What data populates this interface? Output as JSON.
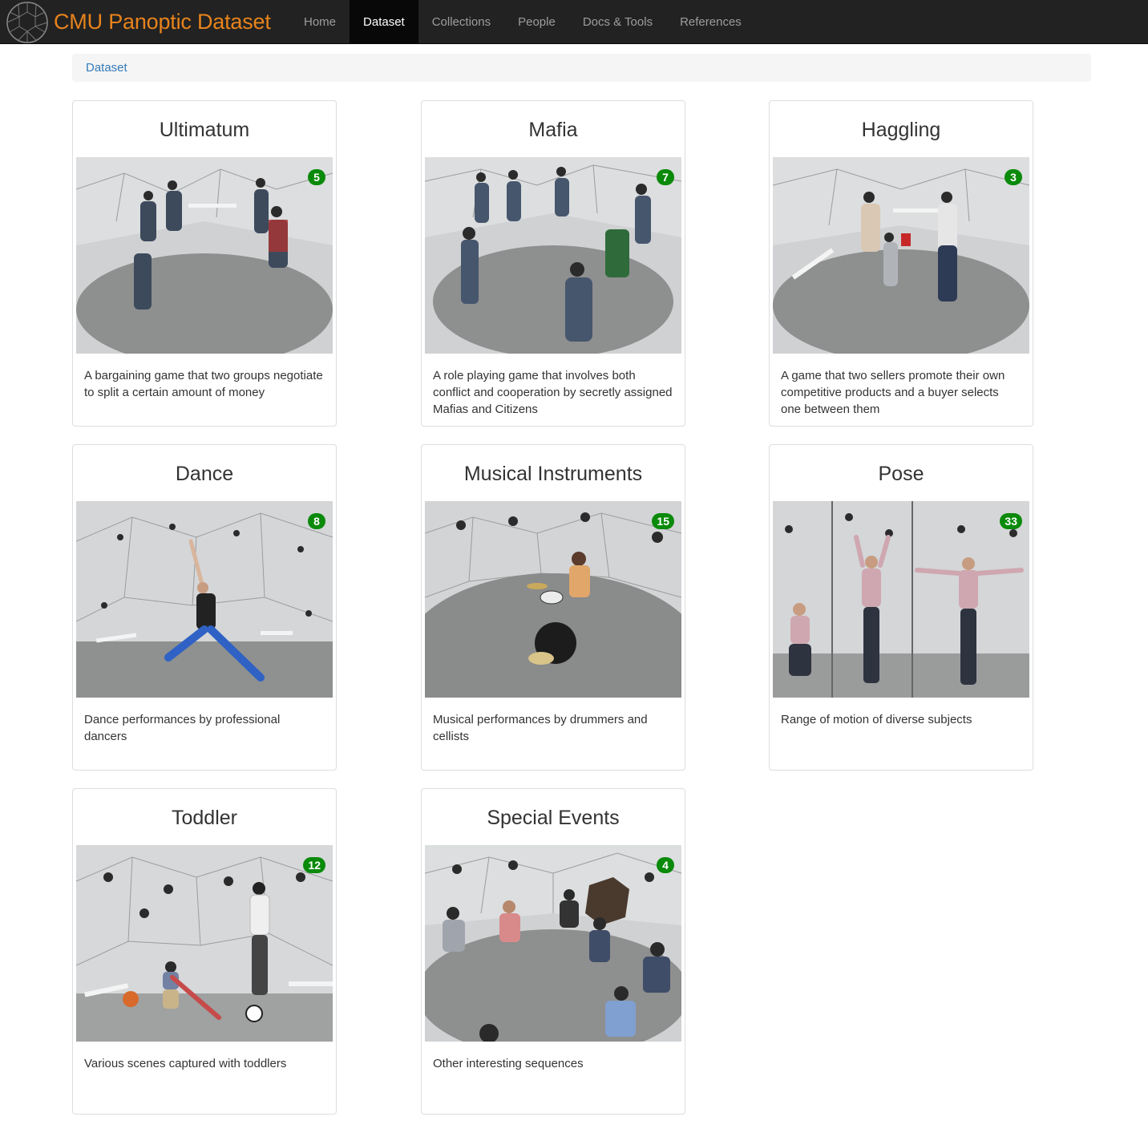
{
  "navbar": {
    "brand": "CMU Panoptic Dataset",
    "brand_logo": "geodesic-dome-icon",
    "brand_color": "#e8831c",
    "items": [
      {
        "label": "Home",
        "active": false
      },
      {
        "label": "Dataset",
        "active": true
      },
      {
        "label": "Collections",
        "active": false
      },
      {
        "label": "People",
        "active": false
      },
      {
        "label": "Docs & Tools",
        "active": false
      },
      {
        "label": "References",
        "active": false
      }
    ]
  },
  "breadcrumb": {
    "items": [
      "Dataset"
    ]
  },
  "badge_color": "#0a8a0a",
  "cards": [
    {
      "title": "Ultimatum",
      "count": "5",
      "description": "A bargaining game that two groups negotiate to split a certain amount of money"
    },
    {
      "title": "Mafia",
      "count": "7",
      "description": "A role playing game that involves both conflict and cooperation by secretly assigned Mafias and Citizens"
    },
    {
      "title": "Haggling",
      "count": "3",
      "description": "A game that two sellers promote their own competitive products and a buyer selects one between them"
    },
    {
      "title": "Dance",
      "count": "8",
      "description": "Dance performances by professional dancers"
    },
    {
      "title": "Musical Instruments",
      "count": "15",
      "description": "Musical performances by drummers and cellists"
    },
    {
      "title": "Pose",
      "count": "33",
      "description": "Range of motion of diverse subjects"
    },
    {
      "title": "Toddler",
      "count": "12",
      "description": "Various scenes captured with toddlers"
    },
    {
      "title": "Special Events",
      "count": "4",
      "description": "Other interesting sequences"
    }
  ]
}
